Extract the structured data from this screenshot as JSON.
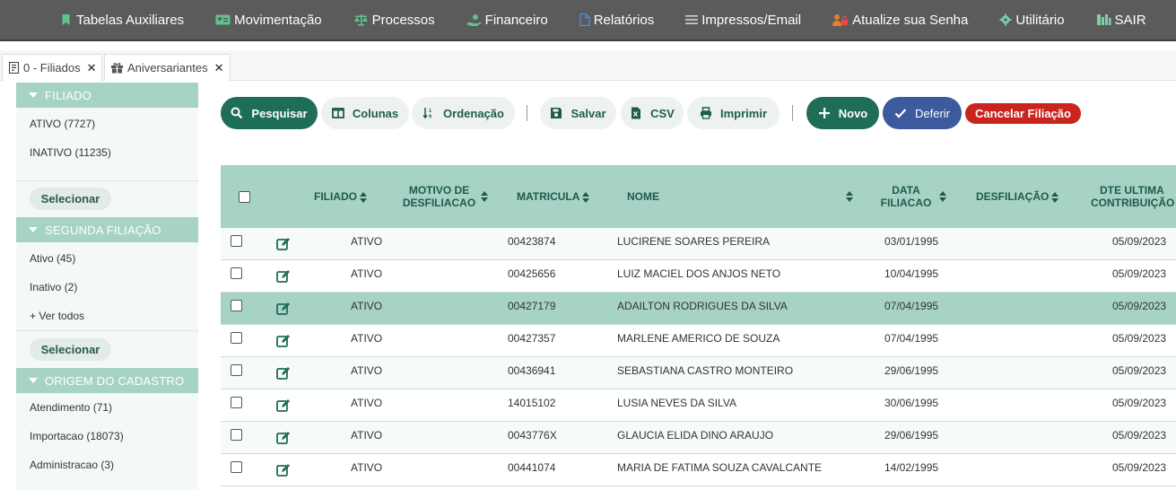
{
  "nav": {
    "items": [
      {
        "label": "Tabelas Auxiliares",
        "icon": "bookmark-icon"
      },
      {
        "label": "Movimentação",
        "icon": "id-card-icon"
      },
      {
        "label": "Processos",
        "icon": "balance-scale-icon"
      },
      {
        "label": "Financeiro",
        "icon": "money-hand-icon"
      },
      {
        "label": "Relatórios",
        "icon": "file-icon"
      },
      {
        "label": "Impressos/Email",
        "icon": "list-icon"
      },
      {
        "label": "Atualize sua Senha",
        "icon": "user-lock-icon"
      },
      {
        "label": "Utilitário",
        "icon": "gear-icon"
      },
      {
        "label": "SAIR",
        "icon": "exit-icon"
      }
    ]
  },
  "tabs": [
    {
      "label": "0 - Filiados",
      "icon": "document-icon"
    },
    {
      "label": "Aniversariantes",
      "icon": "gift-icon"
    }
  ],
  "sidebar": {
    "sections": [
      {
        "title": "FILIADO",
        "items": [
          "ATIVO (7727)",
          "INATIVO (11235)"
        ],
        "button": "Selecionar"
      },
      {
        "title": "SEGUNDA FILIAÇÃO",
        "items": [
          "Ativo (45)",
          "Inativo (2)",
          "+ Ver todos"
        ],
        "button": "Selecionar"
      },
      {
        "title": "ORIGEM DO CADASTRO",
        "items": [
          "Atendimento (71)",
          "Importacao (18073)",
          "Administracao (3)"
        ]
      }
    ]
  },
  "toolbar": {
    "pesquisar": "Pesquisar",
    "colunas": "Colunas",
    "ordenacao": "Ordenação",
    "salvar": "Salvar",
    "csv": "CSV",
    "imprimir": "Imprimir",
    "novo": "Novo",
    "deferir": "Deferir",
    "cancelar": "Cancelar Filiação"
  },
  "table": {
    "columns": {
      "filiado": "FILIADO",
      "motivo_1": "MOTIVO DE",
      "motivo_2": "DESFILIACAO",
      "matricula": "MATRICULA",
      "nome": "NOME",
      "data_1": "DATA",
      "data_2": "FILIACAO",
      "desfiliacao": "DESFILIAÇÃO",
      "dte_1": "DTE ULTIMA",
      "dte_2": "CONTRIBUIÇÃO"
    },
    "rows": [
      {
        "filiado": "ATIVO",
        "matricula": "00423874",
        "nome": "LUCIRENE SOARES PEREIRA",
        "data": "03/01/1995",
        "dte": "05/09/2023"
      },
      {
        "filiado": "ATIVO",
        "matricula": "00425656",
        "nome": "LUIZ MACIEL DOS ANJOS NETO",
        "data": "10/04/1995",
        "dte": "05/09/2023"
      },
      {
        "filiado": "ATIVO",
        "matricula": "00427179",
        "nome": "ADAILTON RODRIGUES DA SILVA",
        "data": "07/04/1995",
        "dte": "05/09/2023"
      },
      {
        "filiado": "ATIVO",
        "matricula": "00427357",
        "nome": "MARLENE AMERICO DE SOUZA",
        "data": "07/04/1995",
        "dte": "05/09/2023"
      },
      {
        "filiado": "ATIVO",
        "matricula": "00436941",
        "nome": "SEBASTIANA CASTRO MONTEIRO",
        "data": "29/06/1995",
        "dte": "05/09/2023"
      },
      {
        "filiado": "ATIVO",
        "matricula": "14015102",
        "nome": "LUSIA NEVES DA SILVA",
        "data": "30/06/1995",
        "dte": "05/09/2023"
      },
      {
        "filiado": "ATIVO",
        "matricula": "0043776X",
        "nome": "GLAUCIA ELIDA DINO ARAUJO",
        "data": "29/06/1995",
        "dte": "05/09/2023"
      },
      {
        "filiado": "ATIVO",
        "matricula": "00441074",
        "nome": "MARIA DE FATIMA SOUZA CAVALCANTE",
        "data": "14/02/1995",
        "dte": "05/09/2023"
      }
    ]
  },
  "colors": {
    "nav_bg": "#5b5b5b",
    "primary": "#1e6d56",
    "header_bg": "#a6d3c6",
    "blue": "#3d5a9e",
    "red": "#c9241d"
  }
}
